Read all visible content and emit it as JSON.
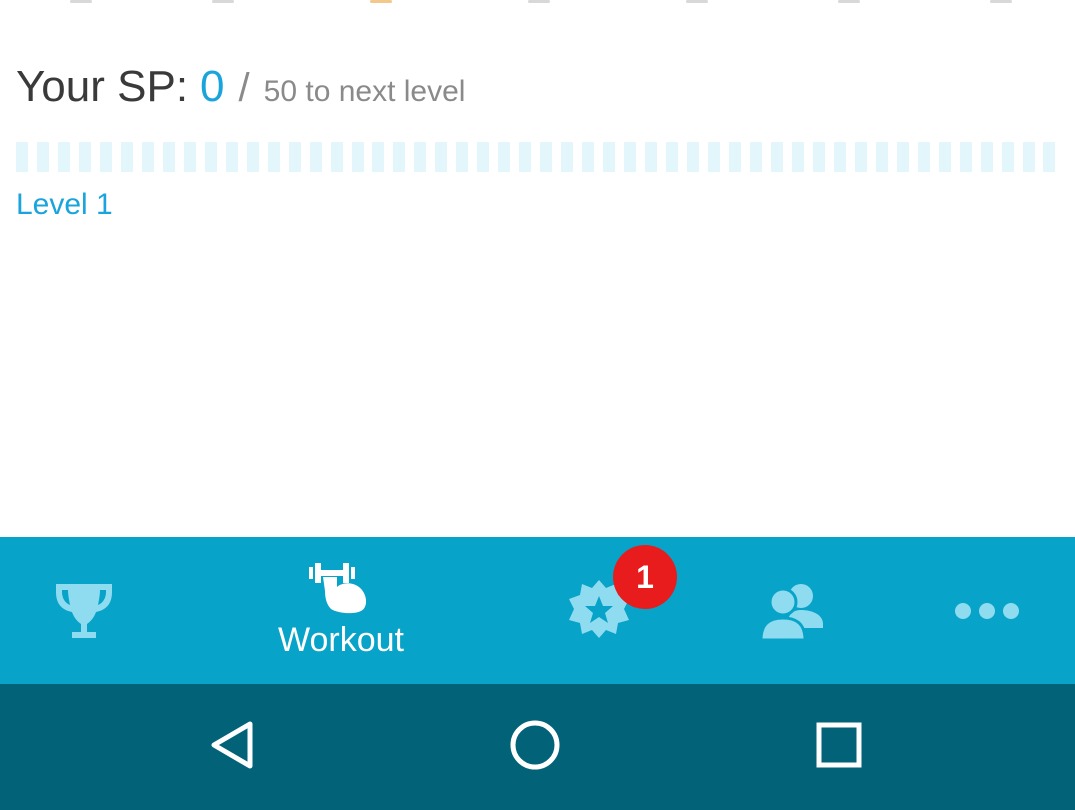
{
  "colors": {
    "accent": "#1aa4dc",
    "tab_bar": "#07a3c8",
    "nav_bar": "#016278",
    "badge": "#e81c1c",
    "progress_empty": "#e3f6fb",
    "inactive_icon": "#8fdcf0"
  },
  "sp": {
    "label": "Your SP:",
    "value": "0",
    "slash": "/",
    "next_level": "50 to next level",
    "progress": 0
  },
  "level": {
    "label": "Level 1"
  },
  "tabbar": {
    "tabs": [
      {
        "icon": "trophy-icon",
        "label": "",
        "active": false
      },
      {
        "icon": "dumbbell-arm-icon",
        "label": "Workout",
        "active": true
      },
      {
        "icon": "star-badge-icon",
        "label": "",
        "active": false,
        "badge": "1"
      },
      {
        "icon": "people-icon",
        "label": "",
        "active": false
      },
      {
        "icon": "more-icon",
        "label": "",
        "active": false
      }
    ]
  },
  "navbar": {
    "buttons": [
      "back-icon",
      "home-icon",
      "recents-icon"
    ]
  }
}
